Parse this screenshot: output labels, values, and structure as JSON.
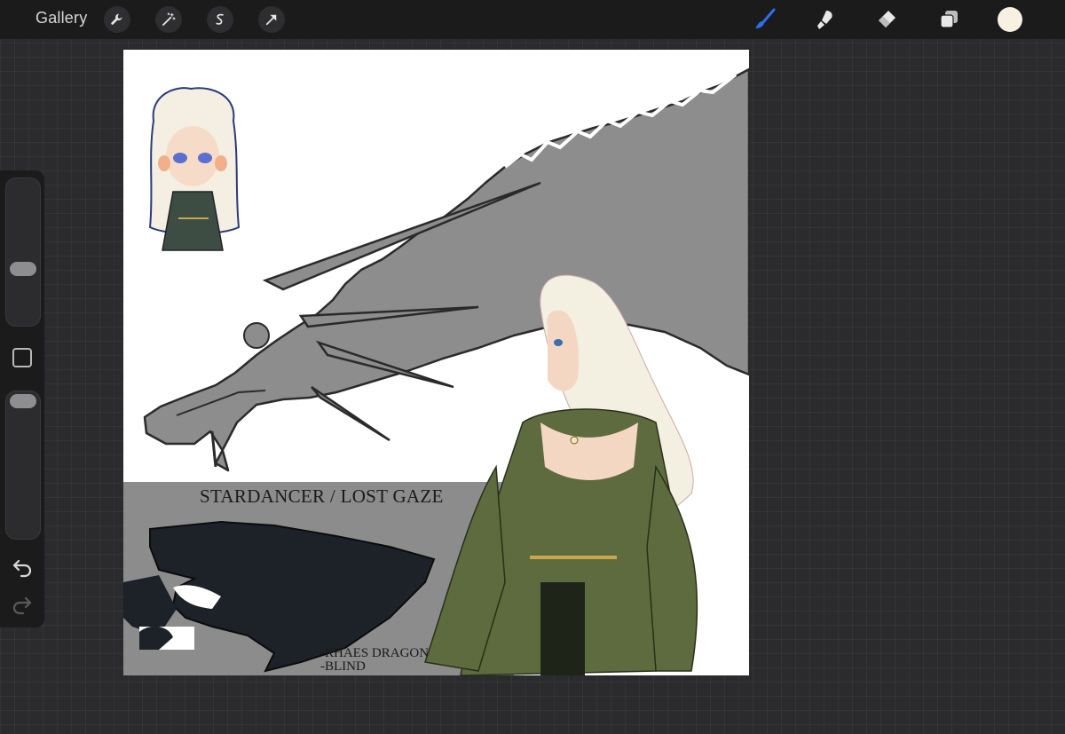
{
  "toolbar": {
    "gallery_label": "Gallery",
    "actions": [
      "wrench-icon",
      "magic-wand-icon",
      "selection-icon",
      "transform-arrow-icon"
    ],
    "tools": [
      "brush-icon",
      "smudge-icon",
      "eraser-icon",
      "layers-icon"
    ],
    "active_tool": "brush",
    "current_color": "#f8f1e2",
    "accent_color": "#2f6df0"
  },
  "sidebar": {
    "controls": [
      "brush-size-slider",
      "modify-button",
      "opacity-slider",
      "undo-icon",
      "redo-icon"
    ]
  },
  "canvas": {
    "title_text": "STARDANCER / LOST GAZE",
    "note_line1": "-RHAES DRAGON",
    "note_line2": "-BLIND"
  }
}
